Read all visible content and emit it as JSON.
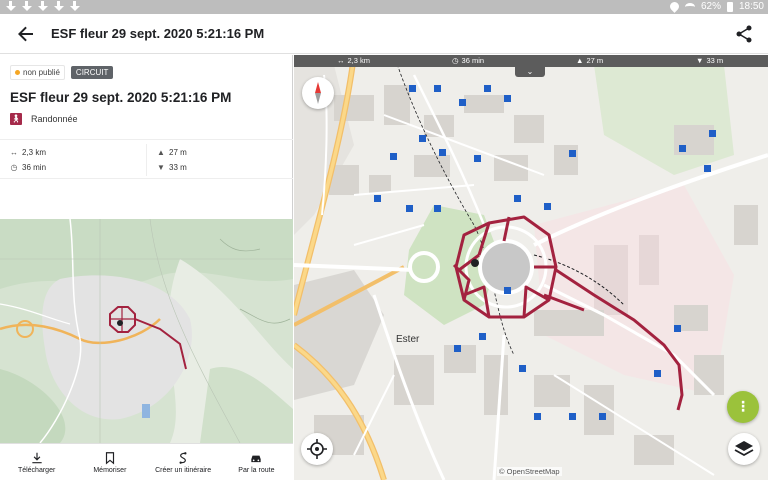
{
  "status_bar": {
    "battery": "62%",
    "time": "18:50"
  },
  "app_bar": {
    "title": "ESF fleur 29 sept. 2020 5:21:16 PM"
  },
  "details": {
    "status_badge": "non publié",
    "type_badge": "CIRCUIT",
    "title": "ESF fleur 29 sept. 2020 5:21:16 PM",
    "activity": "Randonnée",
    "distance": "2,3 km",
    "duration": "36 min",
    "ascent": "27 m",
    "descent": "33 m"
  },
  "bottom_nav": {
    "download": "Télécharger",
    "save": "Mémoriser",
    "create_itinerary": "Créer un itinéraire",
    "by_road": "Par la route"
  },
  "map": {
    "stats": {
      "distance": "2,3 km",
      "duration": "36 min",
      "ascent": "27 m",
      "descent": "33 m"
    },
    "place_label": "Ester",
    "attribution": "© OpenStreetMap",
    "route_color": "#a3223f",
    "fab_color": "#9bc23b"
  },
  "icons": [
    "back-arrow-icon",
    "share-icon",
    "hiking-icon",
    "distance-icon",
    "duration-icon",
    "ascent-icon",
    "descent-icon",
    "download-icon",
    "bookmark-icon",
    "itinerary-icon",
    "car-icon",
    "compass-icon",
    "locate-icon",
    "layers-icon",
    "more-vert-icon",
    "chevron-down-icon"
  ]
}
